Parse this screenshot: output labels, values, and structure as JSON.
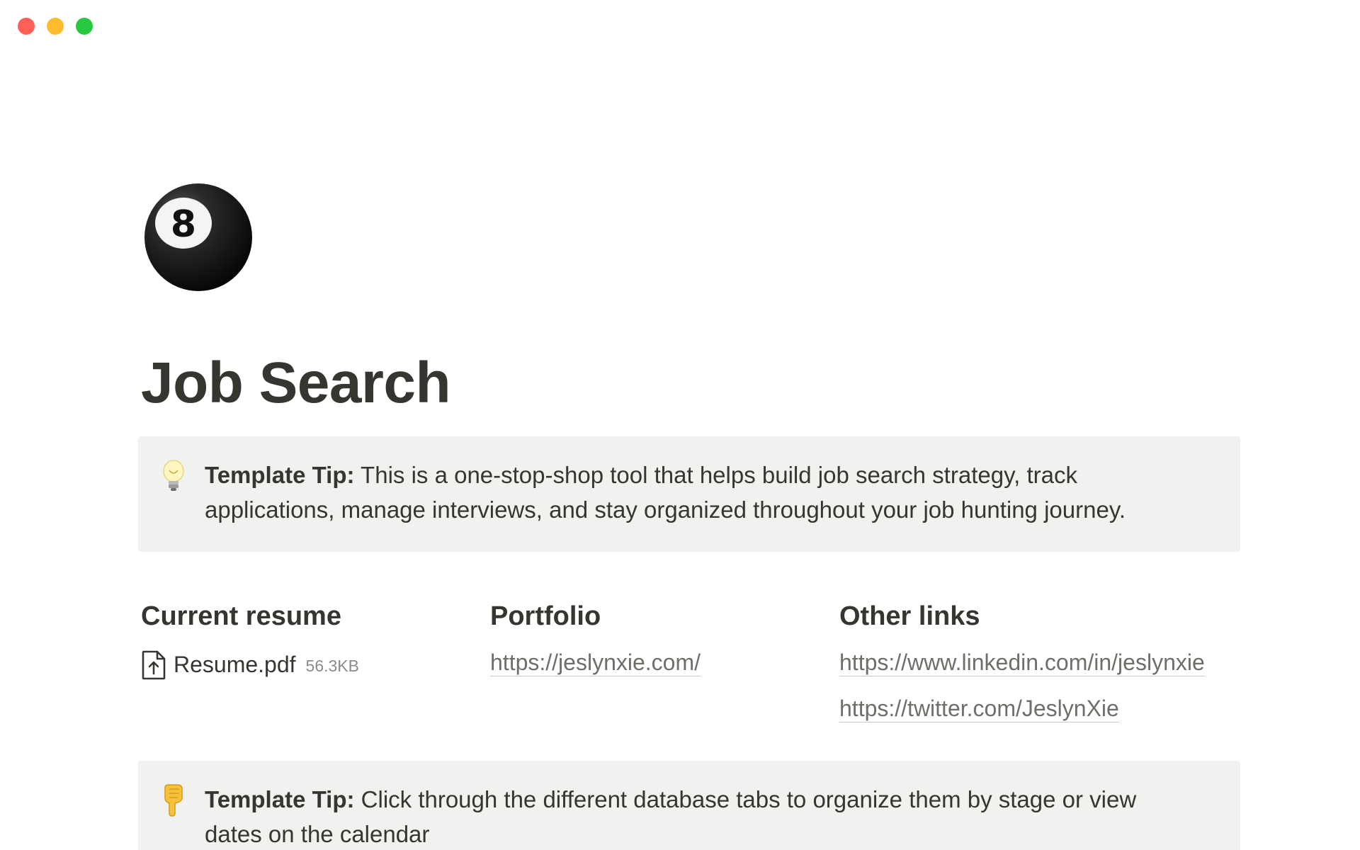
{
  "window": {
    "controls": [
      "close",
      "minimize",
      "maximize"
    ]
  },
  "page": {
    "icon": "8-ball-icon",
    "title": "Job Search"
  },
  "callouts": [
    {
      "icon": "light-bulb-icon",
      "label": "Template Tip:",
      "text": " This is a one-stop-shop tool that helps build job search strategy, track applications, manage interviews, and stay organized throughout your job hunting journey."
    },
    {
      "icon": "pointing-down-hand-icon",
      "label": "Template Tip:",
      "text": " Click through the different database tabs to organize them by stage or view dates on the calendar"
    }
  ],
  "columns": {
    "resume": {
      "heading": "Current resume",
      "file_name": "Resume.pdf",
      "file_size": "56.3KB",
      "file_icon": "file-upload-icon"
    },
    "portfolio": {
      "heading": "Portfolio",
      "links": [
        "https://jeslynxie.com/"
      ]
    },
    "other": {
      "heading": "Other links",
      "links": [
        "https://www.linkedin.com/in/jeslynxie",
        "https://twitter.com/JeslynXie"
      ]
    }
  },
  "colors": {
    "callout_bg": "#f1f1ef",
    "text": "#37352f",
    "link": "#6f6e69",
    "close": "#ff5f57",
    "minimize": "#febc2e",
    "maximize": "#28c840"
  }
}
